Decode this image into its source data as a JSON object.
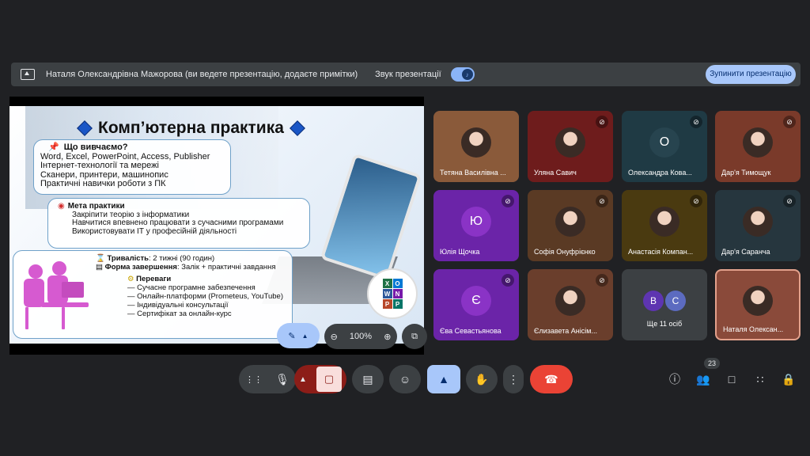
{
  "banner": {
    "presenting_text": "Наталя Олександрівна Мажорова (ви ведете презентацію, додаєте примітки)",
    "sound_label": "Звук презентації",
    "sound_on": true,
    "stop_button": "Зупинити презентацію"
  },
  "slide": {
    "title": "Комп’ютерна практика",
    "section1": {
      "heading": "Що вивчаємо?",
      "lines": [
        "Word, Excel, PowerPoint, Access, Publisher",
        "Інтернет-технології та мережі",
        "Сканери, принтери, машинопис",
        "Практичні навички роботи з ПК"
      ]
    },
    "section2": {
      "heading": "Мета практики",
      "lines": [
        "Закріпити теорію з інформатики",
        "Навчитися впевнено працювати з сучасними програмами",
        "Використовувати ІТ у професійній діяльності"
      ]
    },
    "section3": {
      "duration_label": "Тривалість",
      "duration_value": ": 2 тижні (90 годин)",
      "completion_label": "Форма завершення",
      "completion_value": ": Залік + практичні завдання",
      "benefits_heading": "Переваги",
      "benefits": [
        "— Сучасне програмне забезпечення",
        "— Онлайн-платформи (Prometeus, YouTube)",
        "— Індивідуальні консультації",
        "— Сертифікат за онлайн-курс"
      ]
    },
    "office_letters": [
      "X",
      "O",
      "W",
      "N",
      "P",
      "P"
    ],
    "zoom_level": "100%"
  },
  "participants": [
    {
      "name": "Тетяна Василівна ...",
      "type": "photo",
      "muted": false,
      "bg": "#8a5a3a"
    },
    {
      "name": "Уляна Савич",
      "type": "photo",
      "muted": true,
      "bg": "#6e1c1c"
    },
    {
      "name": "Олександра Кова...",
      "type": "initial",
      "initial": "О",
      "muted": true,
      "bg": "#1f3a44",
      "avatar_bg": "#27444f"
    },
    {
      "name": "Дар'я Тимощук",
      "type": "photo",
      "muted": true,
      "bg": "#7a3a2a"
    },
    {
      "name": "Юлія Щочка",
      "type": "initial",
      "initial": "Ю",
      "muted": true,
      "bg": "#6b24a8",
      "avatar_bg": "#8a33c6"
    },
    {
      "name": "Софія Онуфрієнко",
      "type": "photo",
      "muted": true,
      "bg": "#5a3a24"
    },
    {
      "name": "Анастасія Компан...",
      "type": "photo",
      "muted": true,
      "bg": "#4a3a10"
    },
    {
      "name": "Дар'я Саранча",
      "type": "photo",
      "muted": true,
      "bg": "#26363e"
    },
    {
      "name": "Єва Севастьянова",
      "type": "initial",
      "initial": "Є",
      "muted": true,
      "bg": "#6b24a8",
      "avatar_bg": "#8a33c6"
    },
    {
      "name": "Єлизавета Анісім...",
      "type": "photo",
      "muted": true,
      "bg": "#6a3e2c"
    },
    {
      "name": "Ще 11 осіб",
      "type": "more",
      "initials": [
        "В",
        "С"
      ],
      "muted": false,
      "bg": "#3c4043"
    },
    {
      "name": "Наталя Олексан...",
      "type": "photo",
      "muted": false,
      "bg": "#8a4a3a",
      "selected": true
    }
  ],
  "toolbar": {
    "icons": [
      "audio-wave-icon",
      "microphone-icon",
      "chevron-up-icon",
      "camera-off-icon",
      "captions-icon",
      "emoji-icon",
      "present-icon",
      "raise-hand-icon",
      "more-options-icon",
      "end-call-icon"
    ],
    "right_icons": [
      "info-icon",
      "people-icon",
      "chat-icon",
      "activities-icon",
      "host-controls-icon"
    ],
    "participant_count": "23"
  },
  "colors": {
    "background": "#202124",
    "accent": "#a8c7fa",
    "end_call": "#ea4335",
    "camera_off": "#f9dedc"
  }
}
